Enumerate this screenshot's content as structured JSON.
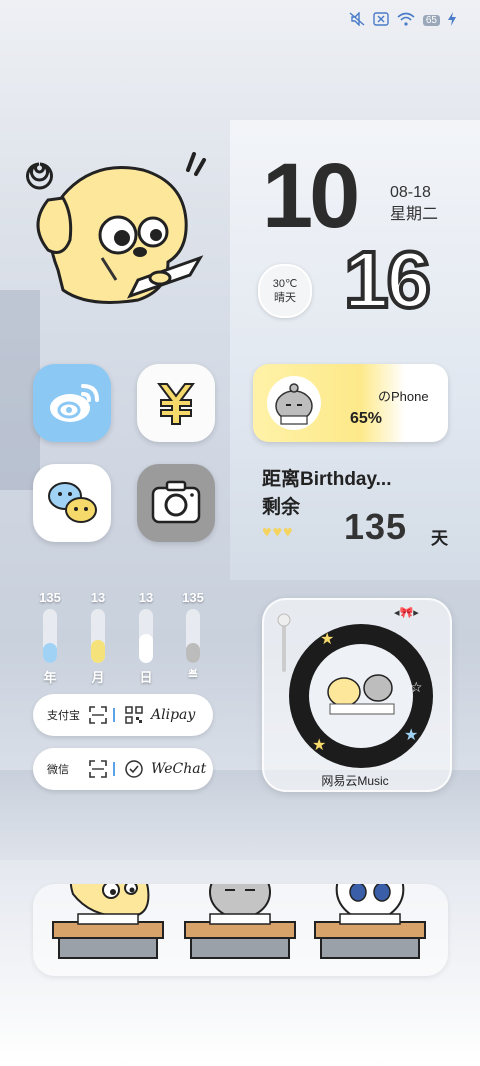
{
  "status_bar": {
    "icons": [
      "mute-icon",
      "no-sim-icon",
      "wifi-icon",
      "battery-icon",
      "charging-icon"
    ],
    "battery": "65"
  },
  "clock": {
    "hour": "10",
    "minute": "16",
    "date": "08-18",
    "weekday": "星期二"
  },
  "weather": {
    "temp": "30℃",
    "condition": "晴天"
  },
  "apps": [
    {
      "name": "weibo",
      "icon": "weibo-icon",
      "bg": "#7fc1f2"
    },
    {
      "name": "yuan",
      "icon": "yuan-icon",
      "bg": "#ffffff"
    },
    {
      "name": "wechat",
      "icon": "wechat-icon",
      "bg": "#ffffff"
    },
    {
      "name": "camera",
      "icon": "camera-icon",
      "bg": "#9c9c9c"
    }
  ],
  "phone_widget": {
    "name": "のPhone",
    "percent": "65%",
    "battery_level": 0.65
  },
  "birthday": {
    "title": "距离Birthday...",
    "remaining": "剩余",
    "days": "135",
    "unit": "天"
  },
  "progress": [
    {
      "value": "135",
      "label": "年",
      "fill": 0.37,
      "color": "#9fd2f5"
    },
    {
      "value": "13",
      "label": "月",
      "fill": 0.42,
      "color": "#f5e27a"
    },
    {
      "value": "13",
      "label": "日",
      "fill": 0.54,
      "color": "#ffffff"
    },
    {
      "value": "135",
      "label": "≝",
      "fill": 0.37,
      "color": "#bcbcbc"
    }
  ],
  "pay": [
    {
      "name": "支付宝",
      "script": "Alipay"
    },
    {
      "name": "微信",
      "script": "WeChat"
    }
  ],
  "music": {
    "label": "网易云Music"
  },
  "colors": {
    "accent_blue": "#5aa3e8",
    "yellow": "#fde98a",
    "dark_text": "#2c2c2c"
  }
}
